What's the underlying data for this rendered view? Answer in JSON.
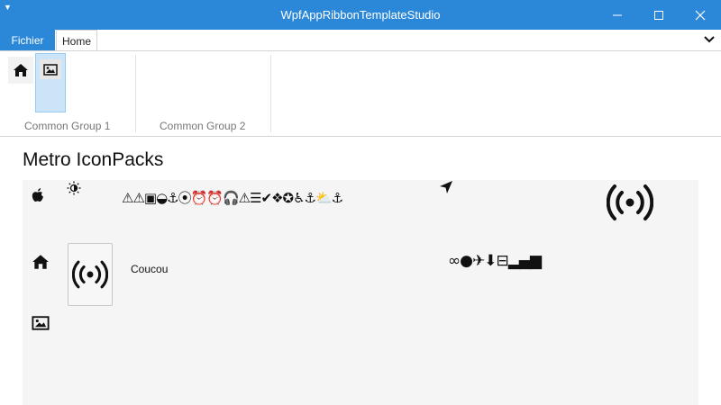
{
  "window": {
    "title": "WpfAppRibbonTemplateStudio",
    "controls": {
      "minimize": "minimize-icon",
      "maximize": "maximize-icon",
      "close": "close-icon"
    }
  },
  "ribbon": {
    "file_tab": "Fichier",
    "tabs": [
      {
        "label": "Home",
        "selected": true
      }
    ],
    "groups": [
      {
        "label": "Common Group 1",
        "buttons": [
          "home-icon",
          "image-icon"
        ]
      },
      {
        "label": "Common Group 2",
        "buttons": []
      }
    ]
  },
  "main": {
    "heading": "Metro IconPacks",
    "icon_strip_1": "⚠⚠▣◒⚓⦿⏰⏰🎧⚠☰✔❖✪♿⚓⛅⚓",
    "icon_strip_2": "∞●✈⬇⊟▂▄▆",
    "tile_label": "Coucou",
    "colors": {
      "accent": "#2b88d8",
      "panel": "#f5f5f5",
      "selected_button": "#cce4f7"
    }
  }
}
